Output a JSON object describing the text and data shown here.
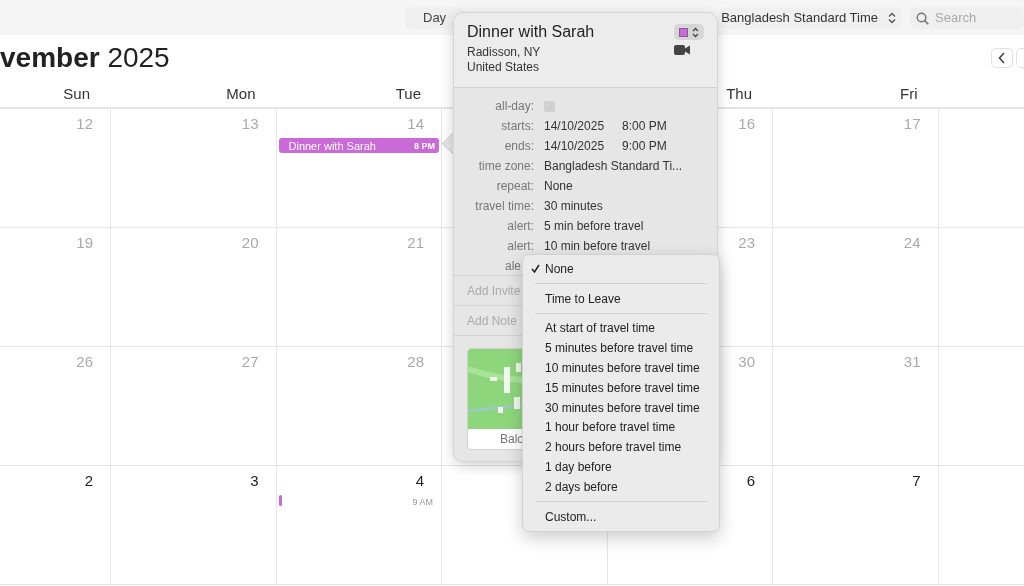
{
  "toolbar": {
    "view_button": "Day",
    "timezone": "Bangladesh Standard Time",
    "search_placeholder": "Search"
  },
  "header": {
    "month": "vember",
    "year": "2025"
  },
  "columns": [
    {
      "label": "Sun"
    },
    {
      "label": "Mon"
    },
    {
      "label": "Tue"
    },
    {
      "label": "Thu"
    },
    {
      "label": "Fri"
    }
  ],
  "weeks": [
    {
      "days": [
        {
          "date": "12",
          "current_month": false
        },
        {
          "date": "13",
          "current_month": false
        },
        {
          "date": "14",
          "current_month": false,
          "events": [
            {
              "kind": "bar",
              "title": "Dinner with Sarah",
              "time": "8 PM",
              "color": "#c96ad8"
            }
          ]
        },
        {
          "date": "16",
          "current_month": false
        },
        {
          "date": "17",
          "current_month": false
        }
      ]
    },
    {
      "days": [
        {
          "date": "19",
          "current_month": false
        },
        {
          "date": "20",
          "current_month": false
        },
        {
          "date": "21",
          "current_month": false
        },
        {
          "date": "23",
          "current_month": false
        },
        {
          "date": "24",
          "current_month": false
        }
      ]
    },
    {
      "days": [
        {
          "date": "26",
          "current_month": false
        },
        {
          "date": "27",
          "current_month": false
        },
        {
          "date": "28",
          "current_month": false
        },
        {
          "date": "30",
          "current_month": false
        },
        {
          "date": "31",
          "current_month": false
        }
      ]
    },
    {
      "days": [
        {
          "date": "2",
          "current_month": true
        },
        {
          "date": "3",
          "current_month": true
        },
        {
          "date": "4",
          "current_month": true,
          "events": [
            {
              "kind": "marker",
              "time": "9 AM",
              "color": "#c96ad8"
            }
          ]
        },
        {
          "date": "6",
          "current_month": true
        },
        {
          "date": "7",
          "current_month": true
        }
      ]
    }
  ],
  "popover": {
    "title": "Dinner with Sarah",
    "color": "#c96ad8",
    "location": [
      "Radisson, NY",
      "United States"
    ],
    "fields": [
      {
        "kind": "checkbox",
        "label": "all-day:",
        "checked": false
      },
      {
        "kind": "datetime",
        "label": "starts:",
        "date": "14/10/2025",
        "time": "8:00 PM"
      },
      {
        "kind": "datetime",
        "label": "ends:",
        "date": "14/10/2025",
        "time": "9:00 PM"
      },
      {
        "kind": "text",
        "label": "time zone:",
        "value": "Bangladesh Standard Ti..."
      },
      {
        "kind": "text",
        "label": "repeat:",
        "value": "None"
      },
      {
        "kind": "text",
        "label": "travel time:",
        "value": "30 minutes"
      },
      {
        "kind": "text",
        "label": "alert:",
        "value": "5 min before travel"
      },
      {
        "kind": "text",
        "label": "alert:",
        "value": "10 min before travel"
      },
      {
        "kind": "text",
        "label": "ale"
      }
    ],
    "invitees_placeholder": "Add Invite",
    "notes_placeholder": "Add Note",
    "map_label": "Balc"
  },
  "menu": [
    {
      "kind": "item",
      "label": "None",
      "selected": true
    },
    {
      "kind": "separator"
    },
    {
      "kind": "item",
      "label": "Time to Leave",
      "selected": false
    },
    {
      "kind": "separator"
    },
    {
      "kind": "item",
      "label": "At start of travel time",
      "selected": false
    },
    {
      "kind": "item",
      "label": "5 minutes before travel time",
      "selected": false
    },
    {
      "kind": "item",
      "label": "10 minutes before travel time",
      "selected": false
    },
    {
      "kind": "item",
      "label": "15 minutes before travel time",
      "selected": false
    },
    {
      "kind": "item",
      "label": "30 minutes before travel time",
      "selected": false
    },
    {
      "kind": "item",
      "label": "1 hour before travel time",
      "selected": false
    },
    {
      "kind": "item",
      "label": "2 hours before travel time",
      "selected": false
    },
    {
      "kind": "item",
      "label": "1 day before",
      "selected": false
    },
    {
      "kind": "item",
      "label": "2 days before",
      "selected": false
    },
    {
      "kind": "separator"
    },
    {
      "kind": "item",
      "label": "Custom...",
      "selected": false
    }
  ]
}
